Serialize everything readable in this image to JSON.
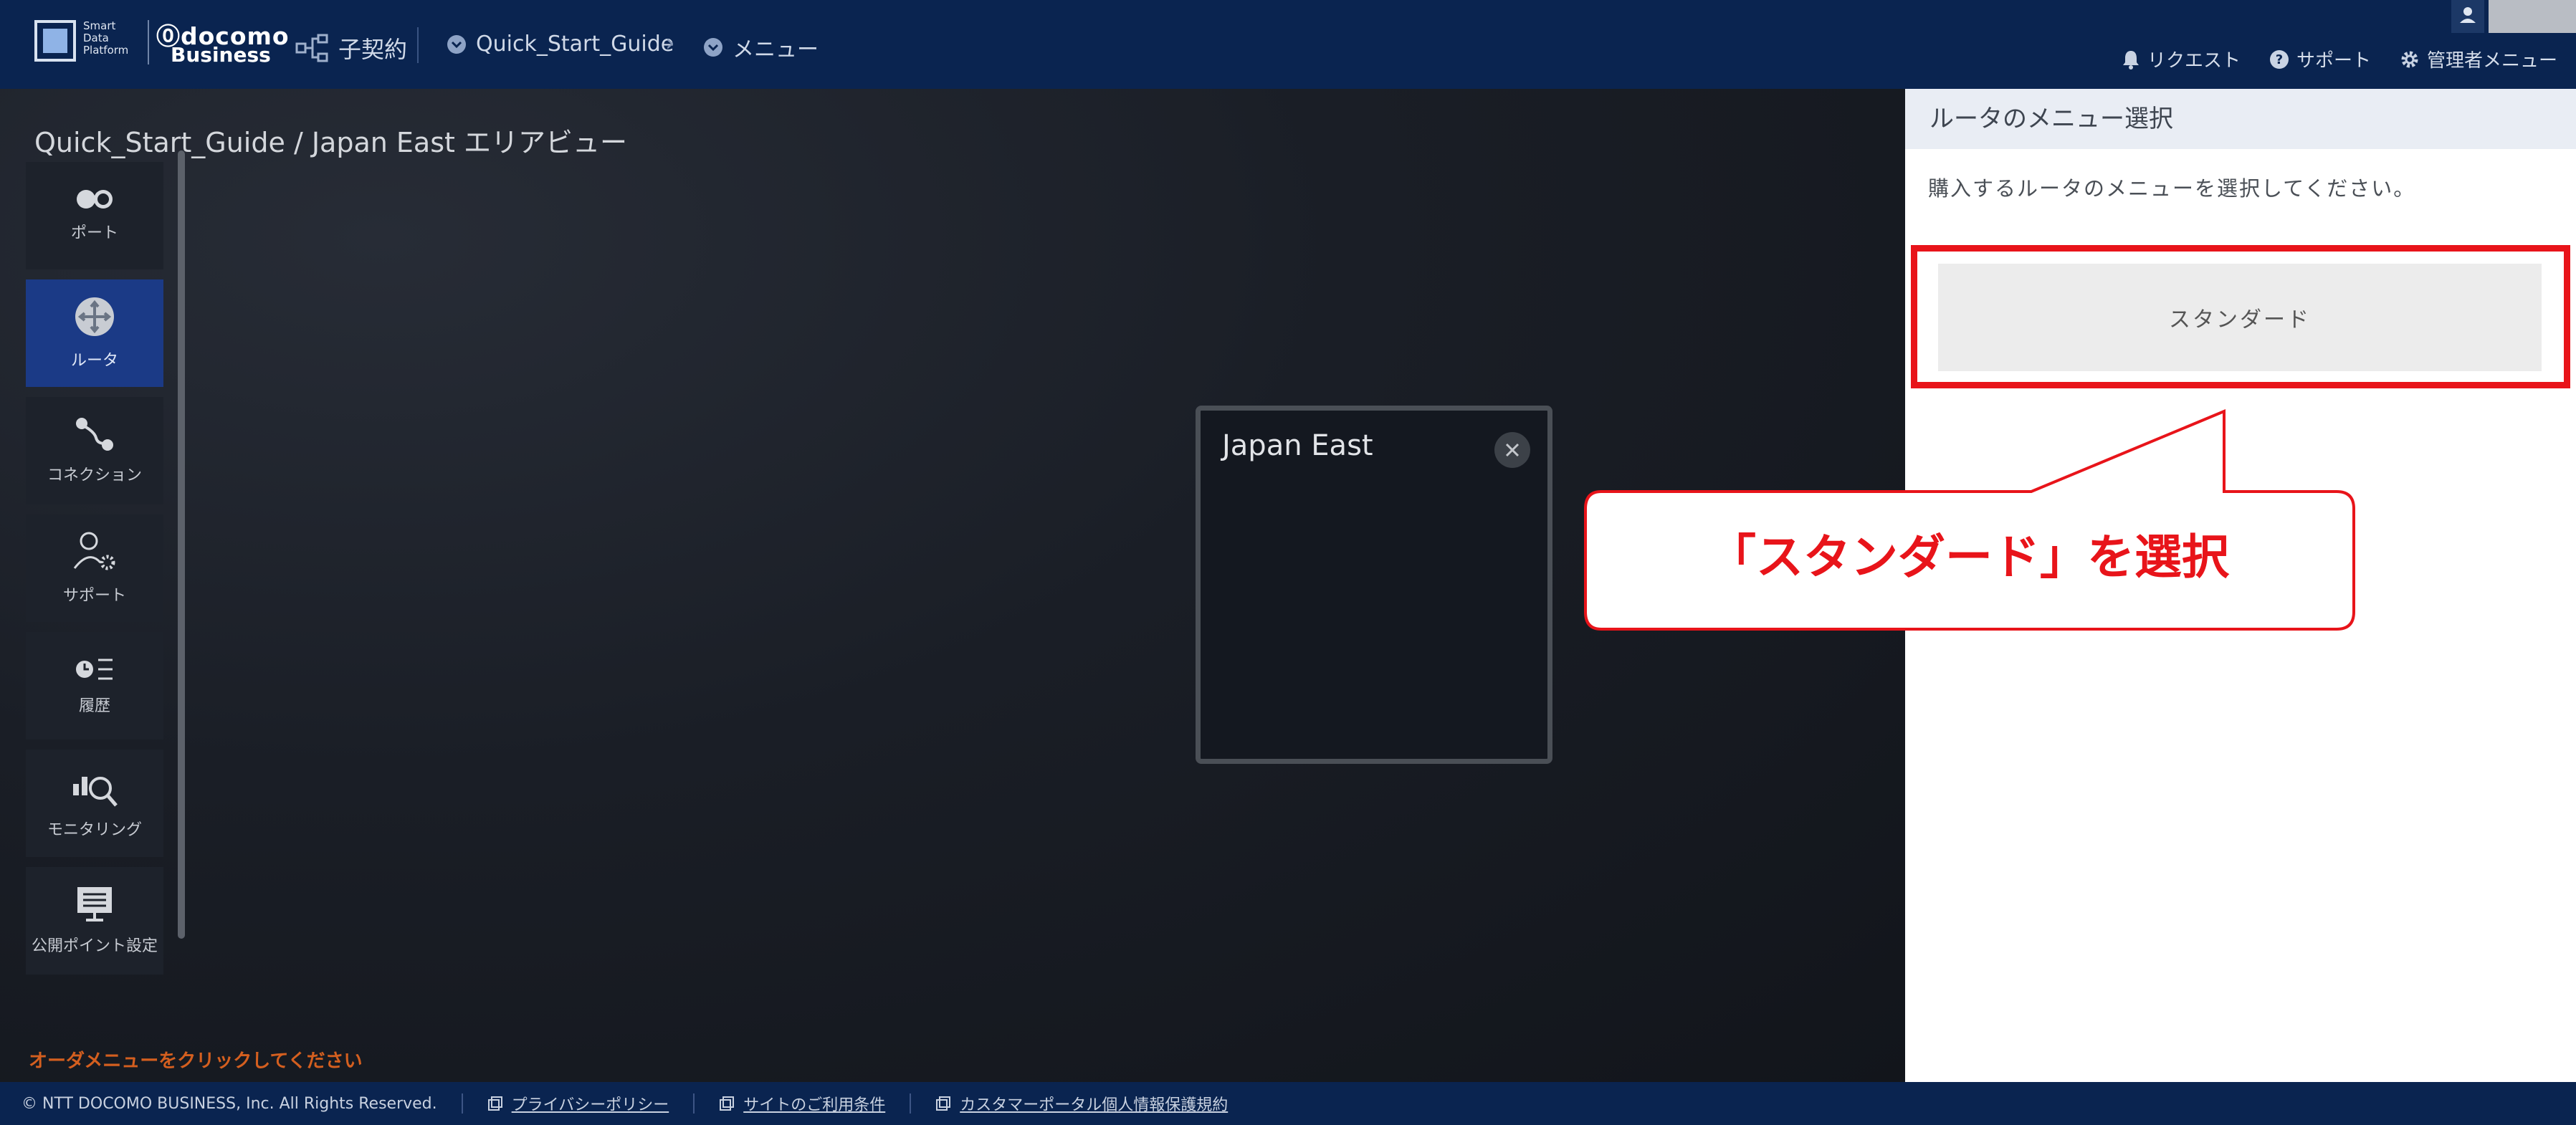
{
  "header": {
    "logo_sdp_line1": "Smart",
    "logo_sdp_line2": "Data",
    "logo_sdp_line3": "Platform",
    "logo_docomo": "docomo",
    "logo_business": "Business",
    "contract_label": "子契約",
    "breadcrumb_project": "Quick_Start_Guide",
    "breadcrumb_menu": "メニュー",
    "links": {
      "request": "リクエスト",
      "support": "サポート",
      "admin_menu": "管理者メニュー"
    }
  },
  "canvas": {
    "view_title": "Quick_Start_Guide / Japan East エリアビュー",
    "area_name": "Japan East",
    "order_hint": "オーダメニューをクリックしてください"
  },
  "sidebar": {
    "items": [
      {
        "label": "ポート",
        "icon": "port-icon"
      },
      {
        "label": "ルータ",
        "icon": "router-icon",
        "active": true
      },
      {
        "label": "コネクション",
        "icon": "connection-icon"
      },
      {
        "label": "サポート",
        "icon": "support-icon"
      },
      {
        "label": "履歴",
        "icon": "history-icon"
      },
      {
        "label": "モニタリング",
        "icon": "monitoring-icon"
      },
      {
        "label": "公開ポイント設定",
        "icon": "public-point-icon"
      }
    ]
  },
  "panel": {
    "title": "ルータのメニュー選択",
    "description": "購入するルータのメニューを選択してください。",
    "option_standard": "スタンダード"
  },
  "callout": {
    "text": "「スタンダード」を選択"
  },
  "footer": {
    "copyright": "© NTT DOCOMO BUSINESS, Inc. All Rights Reserved.",
    "privacy": "プライバシーポリシー",
    "terms": "サイトのご利用条件",
    "customer_privacy": "カスタマーポータル個人情報保護規約"
  },
  "colors": {
    "header_bg": "#0a2450",
    "active_sidebar": "#1b3a86",
    "highlight_red": "#e8141a",
    "order_hint": "#d45f1f"
  }
}
